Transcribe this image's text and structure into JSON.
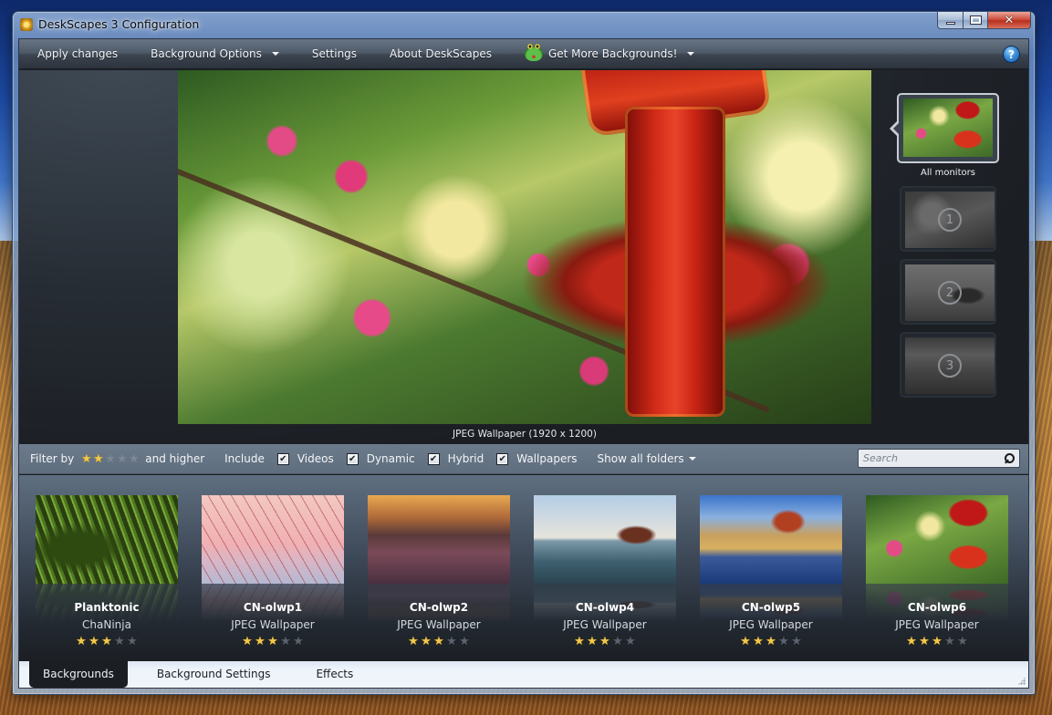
{
  "window": {
    "title": "DeskScapes 3 Configuration",
    "controls": {
      "minimize": "minimize",
      "maximize": "maximize",
      "close": "✕"
    }
  },
  "menubar": {
    "items": [
      {
        "label": "Apply changes",
        "dropdown": false
      },
      {
        "label": "Background Options",
        "dropdown": true
      },
      {
        "label": "Settings",
        "dropdown": false
      },
      {
        "label": "About DeskScapes",
        "dropdown": false
      },
      {
        "label": "Get More Backgrounds!",
        "dropdown": true,
        "icon": "frog-icon"
      }
    ],
    "help_label": "?"
  },
  "preview": {
    "caption": "JPEG Wallpaper (1920 x 1200)"
  },
  "monitors": {
    "all_label": "All monitors",
    "items": [
      {
        "number": "1"
      },
      {
        "number": "2"
      },
      {
        "number": "3"
      }
    ]
  },
  "filter": {
    "filter_by_label": "Filter by",
    "rating": 2,
    "rating_max": 5,
    "and_higher_label": "and higher",
    "include_label": "Include",
    "checks": [
      {
        "label": "Videos",
        "checked": true
      },
      {
        "label": "Dynamic",
        "checked": true
      },
      {
        "label": "Hybrid",
        "checked": true
      },
      {
        "label": "Wallpapers",
        "checked": true
      }
    ],
    "folders_label": "Show all folders",
    "search_placeholder": "Search",
    "search_value": ""
  },
  "gallery": {
    "items": [
      {
        "title": "Planktonic",
        "subtitle": "ChaNinja",
        "rating": 3,
        "rating_max": 5,
        "thumb": "img-plank"
      },
      {
        "title": "CN-olwp1",
        "subtitle": "JPEG Wallpaper",
        "rating": 3,
        "rating_max": 5,
        "thumb": "img-grass"
      },
      {
        "title": "CN-olwp2",
        "subtitle": "JPEG Wallpaper",
        "rating": 3,
        "rating_max": 5,
        "thumb": "img-wall"
      },
      {
        "title": "CN-olwp4",
        "subtitle": "JPEG Wallpaper",
        "rating": 3,
        "rating_max": 5,
        "thumb": "img-boat"
      },
      {
        "title": "CN-olwp5",
        "subtitle": "JPEG Wallpaper",
        "rating": 3,
        "rating_max": 5,
        "thumb": "img-palace"
      },
      {
        "title": "CN-olwp6",
        "subtitle": "JPEG Wallpaper",
        "rating": 3,
        "rating_max": 5,
        "thumb": "img-blossom"
      }
    ]
  },
  "tabs": [
    {
      "label": "Backgrounds",
      "active": true
    },
    {
      "label": "Background Settings",
      "active": false
    },
    {
      "label": "Effects",
      "active": false
    }
  ],
  "colors": {
    "star_on": "#f2c84a",
    "dark_bg": "#1b1e23",
    "filter_bar": "#66758a"
  }
}
